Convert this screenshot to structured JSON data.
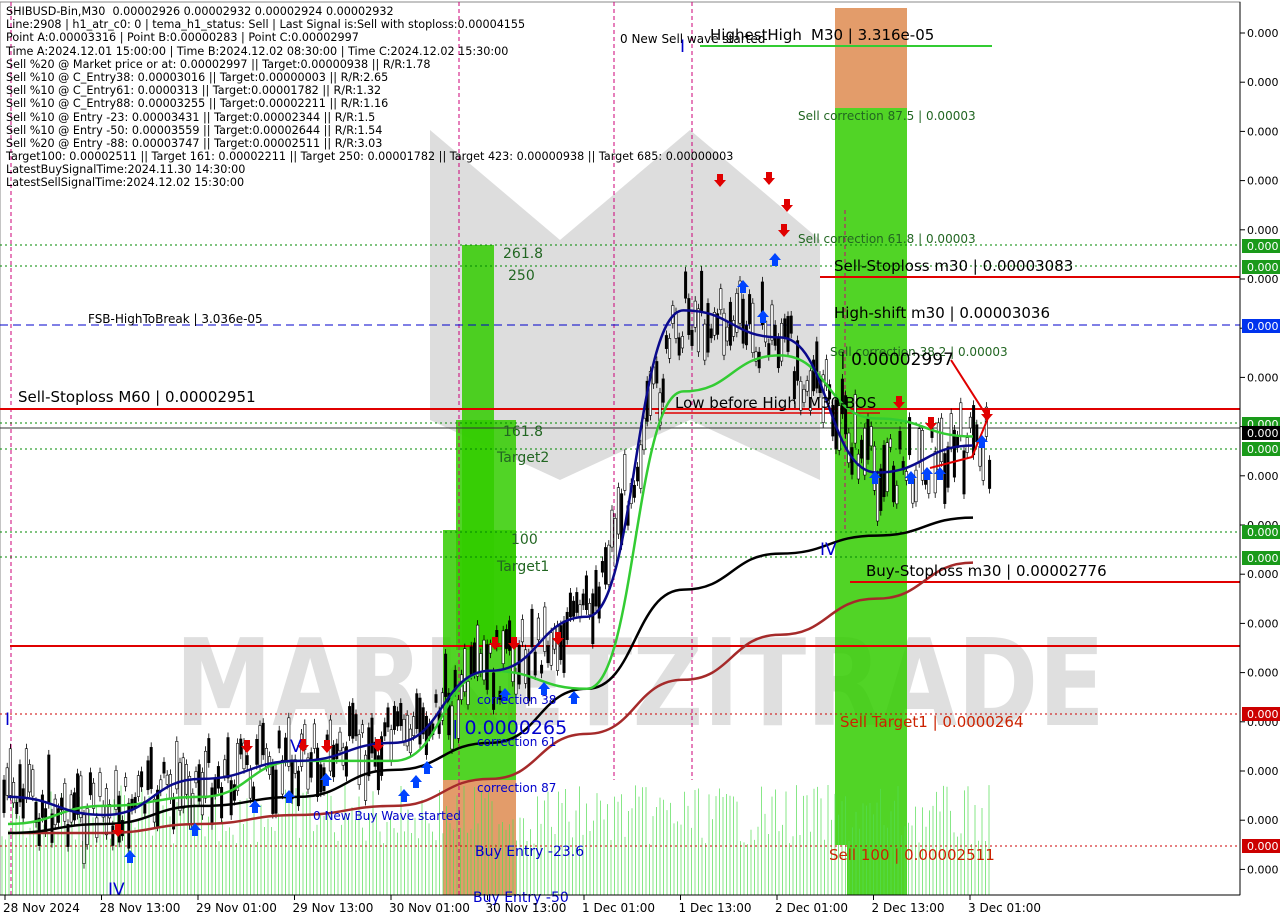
{
  "header_lines": [
    "SHIBUSD-Bin,M30  0.00002926 0.00002932 0.00002924 0.00002932",
    "Line:2908 | h1_atr_c0: 0 | tema_h1_status: Sell | Last Signal is:Sell with stoploss:0.00004155",
    "Point A:0.00003316 | Point B:0.00000283 | Point C:0.00002997",
    "Time A:2024.12.01 15:00:00 | Time B:2024.12.02 08:30:00 | Time C:2024.12.02 15:30:00",
    "Sell %20 @ Market price or at: 0.00002997 || Target:0.00000938 || R/R:1.78",
    "Sell %10 @ C_Entry38: 0.00003016 || Target:0.00000003 || R/R:2.65",
    "Sell %10 @ C_Entry61: 0.0000313 || Target:0.00001782 || R/R:1.32",
    "Sell %10 @ C_Entry88: 0.00003255 || Target:0.00002211 || R/R:1.16",
    "Sell %10 @ Entry -23: 0.00003431 || Target:0.00002344 || R/R:1.5",
    "Sell %10 @ Entry -50: 0.00003559 || Target:0.00002644 || R/R:1.54",
    "Sell %20 @ Entry -88: 0.00003747 || Target:0.00002511 || R/R:3.03",
    "Target100: 0.00002511 || Target 161: 0.00002211 || Target 250: 0.00001782 || Target 423: 0.00000938 || Target 685: 0.00000003",
    "LatestBuySignalTime:2024.11.30 14:30:00",
    "LatestSellSignalTime:2024.12.02 15:30:00"
  ],
  "watermark": "MARKETZITRADE",
  "colors": {
    "red": "#e00000",
    "green_zone": "#33cc00",
    "orange_zone": "#e0915a",
    "blue_ma": "#0a0a8c",
    "green_ma": "#33cc33",
    "black_ma": "#000000",
    "brown_ma": "#a52a2a",
    "dashed_blue": "#0000cc",
    "dotted_green": "#008800",
    "magenta_vline": "#cc0077"
  },
  "price_axis": {
    "tick_labels": [
      "0.000",
      "0.000",
      "0.000",
      "0.000",
      "0.000",
      "0.000",
      "0.000",
      "0.000",
      "0.000",
      "0.000",
      "0.000",
      "0.000",
      "0.000",
      "0.000",
      "0.000",
      "0.000",
      "0.000",
      "0.000"
    ],
    "tags": [
      {
        "text": "0.000",
        "color": "#1a9a1a"
      },
      {
        "text": "0.000",
        "color": "#1a9a1a"
      },
      {
        "text": "0.000",
        "color": "#0033ee"
      },
      {
        "text": "0.000",
        "color": "#1a9a1a"
      },
      {
        "text": "0.000",
        "color": "#000000"
      },
      {
        "text": "0.000",
        "color": "#1a9a1a"
      },
      {
        "text": "0.000",
        "color": "#1a9a1a"
      },
      {
        "text": "0.000",
        "color": "#1a9a1a"
      },
      {
        "text": "0.000",
        "color": "#cc0000"
      },
      {
        "text": "0.000",
        "color": "#cc0000"
      }
    ]
  },
  "time_axis": [
    "28 Nov 2024",
    "28 Nov 13:00",
    "29 Nov 01:00",
    "29 Nov 13:00",
    "30 Nov 01:00",
    "30 Nov 13:00",
    "1 Dec 01:00",
    "1 Dec 13:00",
    "2 Dec 01:00",
    "2 Dec 13:00",
    "3 Dec 01:00"
  ],
  "annotations": {
    "highest_high": "HighestHigh",
    "m30_high": "M30 | 3.316e-05",
    "new_sell_wave": "0 New Sell wave started",
    "sell_corr_875": "Sell correction 87.5 | 0.00003",
    "sell_corr_618": "Sell correction 61.8 | 0.00003",
    "sell_stoploss_m30": "Sell-Stoploss m30 | 0.00003083",
    "high_shift": "High-shift m30 | 0.00003036",
    "fsb": "FSB-HighToBreak | 3.036e-05",
    "sell_stoploss_m60": "Sell-Stoploss M60 | 0.00002951",
    "point_c": "| 0.00002997",
    "sell_corr_382": "Sell correction 38.2 | 0.00003",
    "low_before_high": "Low before High",
    "m30_bos": "M30-BOS",
    "fib_2618": "261.8",
    "fib_250": "250",
    "fib_1618": "161.8",
    "target2": "Target2",
    "fib_100": "100",
    "target1": "Target1",
    "buy_stoploss": "Buy-Stoploss m30 | 0.00002776",
    "sell_target1": "Sell Target1 | 0.0000264",
    "corr_38": "correction 38",
    "price_265": "| 0.0000265",
    "corr_61": "correction 61",
    "corr_87": "correction 87",
    "new_buy_wave": "0 New Buy Wave started",
    "sell_100": "Sell 100 | 0.00002511",
    "buy_entry_236": "Buy Entry -23.6",
    "buy_entry_50": "Buy Entry -50",
    "wave_iv_a": "IV",
    "wave_iv_b": "IV",
    "wave_v": "V",
    "wave_i_a": "I",
    "wave_i_b": "I"
  },
  "chart_data": {
    "type": "line",
    "symbol": "SHIBUSD-Bin",
    "timeframe": "M30",
    "ylim": [
      2.47e-05,
      3.38e-05
    ],
    "x": [
      "28 Nov 2024",
      "28 Nov 13:00",
      "29 Nov 01:00",
      "29 Nov 13:00",
      "30 Nov 01:00",
      "30 Nov 13:00",
      "1 Dec 01:00",
      "1 Dec 13:00",
      "2 Dec 01:00",
      "2 Dec 13:00",
      "3 Dec 01:00"
    ],
    "series": [
      {
        "values": [
          2.54e-05,
          2.52e-05,
          2.56e-05,
          2.58e-05,
          2.6e-05,
          2.68e-05,
          2.74e-05,
          3.08e-05,
          3.05e-05,
          2.9e-05,
          2.93e-05
        ]
      },
      {
        "values": [
          2.51e-05,
          2.53e-05,
          2.54e-05,
          2.58e-05,
          2.58e-05,
          2.68e-05,
          2.66e-05,
          2.99e-05,
          3.03e-05,
          2.96e-05,
          2.94e-05
        ]
      },
      {
        "values": [
          2.5e-05,
          2.51e-05,
          2.53e-05,
          2.54e-05,
          2.57e-05,
          2.6e-05,
          2.66e-05,
          2.77e-05,
          2.81e-05,
          2.83e-05,
          2.85e-05
        ]
      },
      {
        "values": [
          2.5e-05,
          2.5e-05,
          2.51e-05,
          2.52e-05,
          2.53e-05,
          2.56e-05,
          2.61e-05,
          2.67e-05,
          2.72e-05,
          2.76e-05,
          2.8e-05
        ]
      }
    ],
    "levels": [
      {
        "value": 3.316e-05
      },
      {
        "value": 3.083e-05
      },
      {
        "value": 3.036e-05
      },
      {
        "value": 2.951e-05
      },
      {
        "value": 2.776e-05
      },
      {
        "value": 2.64e-05
      },
      {
        "value": 2.511e-05
      }
    ]
  }
}
